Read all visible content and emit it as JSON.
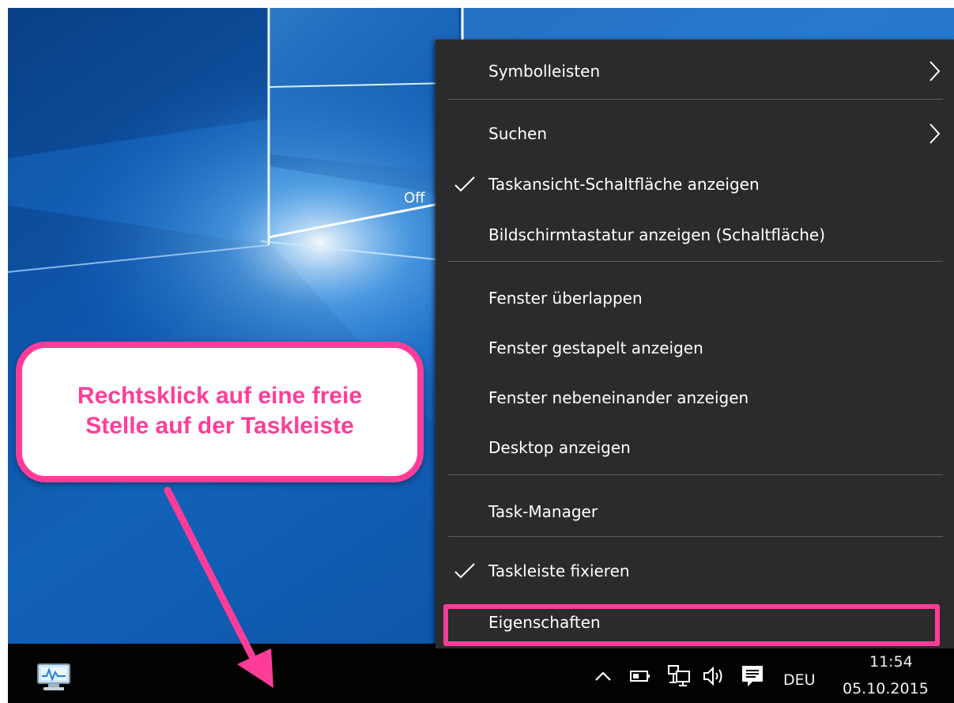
{
  "desktop": {
    "partial_label": "Off"
  },
  "context_menu": {
    "items": [
      {
        "label": "Symbolleisten",
        "checked": false,
        "submenu": true
      },
      {
        "label": "Suchen",
        "checked": false,
        "submenu": true
      },
      {
        "label": "Taskansicht-Schaltfläche anzeigen",
        "checked": true,
        "submenu": false
      },
      {
        "label": "Bildschirmtastatur anzeigen (Schaltfläche)",
        "checked": false,
        "submenu": false
      },
      {
        "label": "Fenster überlappen",
        "checked": false,
        "submenu": false
      },
      {
        "label": "Fenster gestapelt anzeigen",
        "checked": false,
        "submenu": false
      },
      {
        "label": "Fenster nebeneinander anzeigen",
        "checked": false,
        "submenu": false
      },
      {
        "label": "Desktop anzeigen",
        "checked": false,
        "submenu": false
      },
      {
        "label": "Task-Manager",
        "checked": false,
        "submenu": false
      },
      {
        "label": "Taskleiste fixieren",
        "checked": true,
        "submenu": false
      },
      {
        "label": "Eigenschaften",
        "checked": false,
        "submenu": false,
        "highlighted": true
      }
    ]
  },
  "taskbar": {
    "app_icon": "system-monitor-icon",
    "tray_icons": [
      "chevron-up-icon",
      "battery-icon",
      "network-icon",
      "volume-icon",
      "notification-icon"
    ],
    "language": "DEU",
    "time": "11:54",
    "date": "05.10.2015"
  },
  "annotation": {
    "callout_line1": "Rechtsklick auf eine freie",
    "callout_line2": "Stelle auf der Taskleiste"
  },
  "colors": {
    "highlight": "#ff3d99",
    "menu_background": "#2b2b2b",
    "taskbar": "#020203",
    "desktop_blue": "#0c4f9a"
  }
}
